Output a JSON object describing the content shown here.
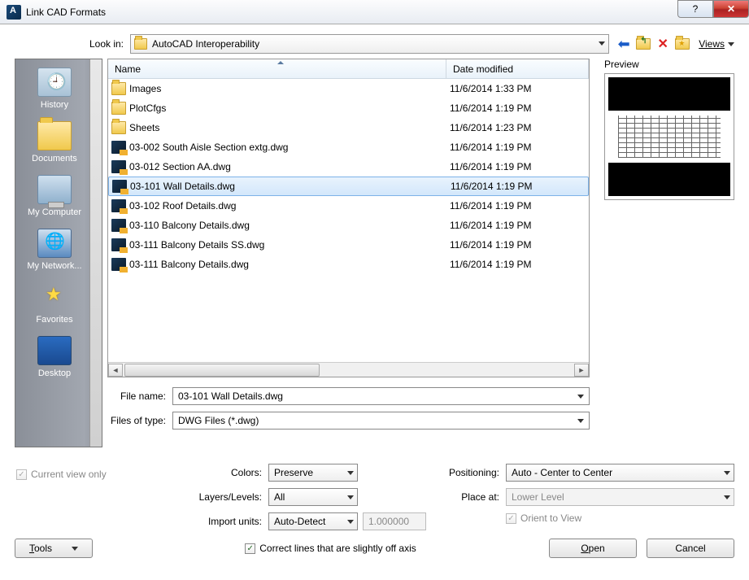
{
  "title": "Link CAD Formats",
  "lookin_label": "Look in:",
  "lookin_value": "AutoCAD Interoperability",
  "views_label": "Views",
  "places": [
    {
      "label": "History",
      "icon": "history"
    },
    {
      "label": "Documents",
      "icon": "folder"
    },
    {
      "label": "My Computer",
      "icon": "computer"
    },
    {
      "label": "My Network...",
      "icon": "network"
    },
    {
      "label": "Favorites",
      "icon": "fav"
    },
    {
      "label": "Desktop",
      "icon": "desktop"
    }
  ],
  "columns": {
    "name": "Name",
    "date": "Date modified"
  },
  "files": [
    {
      "name": "Images",
      "date": "11/6/2014 1:33 PM",
      "type": "folder"
    },
    {
      "name": "PlotCfgs",
      "date": "11/6/2014 1:19 PM",
      "type": "folder"
    },
    {
      "name": "Sheets",
      "date": "11/6/2014 1:23 PM",
      "type": "folder"
    },
    {
      "name": "03-002 South Aisle Section extg.dwg",
      "date": "11/6/2014 1:19 PM",
      "type": "dwg"
    },
    {
      "name": "03-012 Section AA.dwg",
      "date": "11/6/2014 1:19 PM",
      "type": "dwg"
    },
    {
      "name": "03-101 Wall Details.dwg",
      "date": "11/6/2014 1:19 PM",
      "type": "dwg",
      "selected": true
    },
    {
      "name": "03-102 Roof Details.dwg",
      "date": "11/6/2014 1:19 PM",
      "type": "dwg"
    },
    {
      "name": "03-110 Balcony Details.dwg",
      "date": "11/6/2014 1:19 PM",
      "type": "dwg"
    },
    {
      "name": "03-111 Balcony Details SS.dwg",
      "date": "11/6/2014 1:19 PM",
      "type": "dwg"
    },
    {
      "name": "03-111 Balcony Details.dwg",
      "date": "11/6/2014 1:19 PM",
      "type": "dwg"
    }
  ],
  "filename_label": "File name:",
  "filename_value": "03-101 Wall Details.dwg",
  "filetype_label": "Files of type:",
  "filetype_value": "DWG Files  (*.dwg)",
  "preview_label": "Preview",
  "current_view_only": "Current view only",
  "opts": {
    "colors_label": "Colors:",
    "colors_value": "Preserve",
    "layers_label": "Layers/Levels:",
    "layers_value": "All",
    "units_label": "Import units:",
    "units_value": "Auto-Detect",
    "units_num": "1.000000",
    "positioning_label": "Positioning:",
    "positioning_value": "Auto - Center to Center",
    "placeat_label": "Place at:",
    "placeat_value": "Lower Level",
    "orient_label": "Orient to View",
    "correct_label": "Correct lines that are slightly off axis"
  },
  "buttons": {
    "tools": "Tools",
    "open": "Open",
    "cancel": "Cancel"
  }
}
